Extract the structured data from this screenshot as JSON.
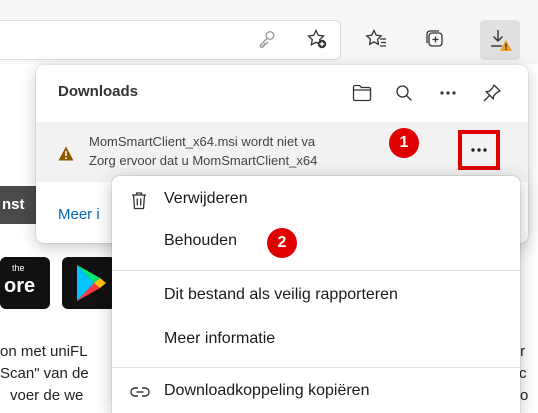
{
  "toolbar": {
    "icons": [
      "key-icon",
      "favorite-add-icon",
      "favorites-icon",
      "collections-icon",
      "downloads-warning-icon"
    ]
  },
  "page": {
    "band_text": "nst",
    "text_left_1": "on met uniFL",
    "text_left_2": "Scan\" van de",
    "text_left_3": "voer de we",
    "text_right_1": "p \"ur",
    "text_right_2": "dat c",
    "text_right_3": "o",
    "badge1_small": "the",
    "badge1_big": "ore"
  },
  "downloads": {
    "title": "Downloads",
    "item_line1": "MomSmartClient_x64.msi wordt niet va",
    "item_line2": "Zorg ervoor dat u MomSmartClient_x64",
    "more_label": "…",
    "link": "Meer i",
    "step1": "1"
  },
  "menu": {
    "items": [
      {
        "label": "Verwijderen",
        "icon": "trash-icon"
      },
      {
        "label": "Behouden",
        "icon": ""
      },
      {
        "label": "Dit bestand als veilig rapporteren",
        "icon": ""
      },
      {
        "label": "Meer informatie",
        "icon": ""
      },
      {
        "label": "Downloadkoppeling kopiëren",
        "icon": "link-icon"
      }
    ],
    "step2": "2"
  },
  "colors": {
    "annotation_red": "#e00000",
    "link_blue": "#0a63b8",
    "warning": "#f0a020"
  }
}
